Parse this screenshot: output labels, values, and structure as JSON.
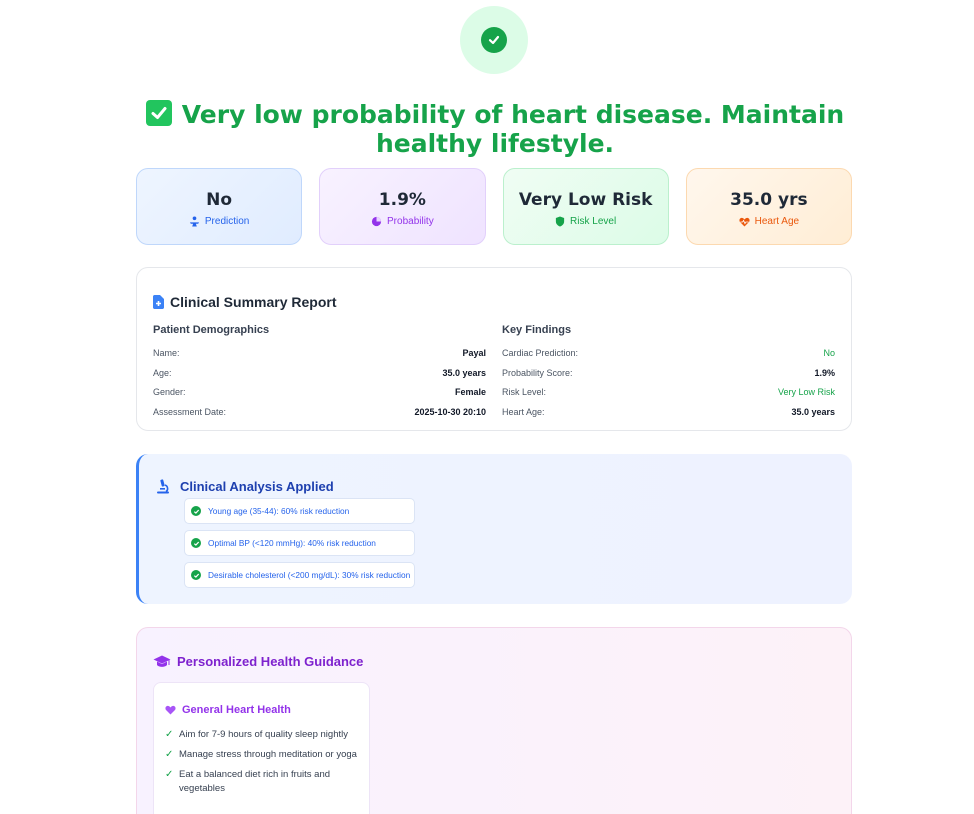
{
  "headline": "Very low probability of heart disease. Maintain healthy lifestyle.",
  "stats": [
    {
      "value": "No",
      "label": "Prediction",
      "icon": "person-icon",
      "color": "#2563eb"
    },
    {
      "value": "1.9%",
      "label": "Probability",
      "icon": "pie-chart-icon",
      "color": "#9333ea"
    },
    {
      "value": "Very Low Risk",
      "label": "Risk Level",
      "icon": "shield-icon",
      "color": "#16a34a"
    },
    {
      "value": "35.0 yrs",
      "label": "Heart Age",
      "icon": "heartbeat-icon",
      "color": "#ea580c"
    }
  ],
  "summary": {
    "title": "Clinical Summary Report",
    "demographics": {
      "heading": "Patient Demographics",
      "rows": [
        {
          "key": "Name:",
          "value": "Payal"
        },
        {
          "key": "Age:",
          "value": "35.0 years"
        },
        {
          "key": "Gender:",
          "value": "Female"
        },
        {
          "key": "Assessment Date:",
          "value": "2025-10-30 20:10"
        }
      ]
    },
    "findings": {
      "heading": "Key Findings",
      "rows": [
        {
          "key": "Cardiac Prediction:",
          "value": "No"
        },
        {
          "key": "Probability Score:",
          "value": "1.9%"
        },
        {
          "key": "Risk Level:",
          "value": "Very Low Risk"
        },
        {
          "key": "Heart Age:",
          "value": "35.0 years"
        }
      ]
    }
  },
  "analysis": {
    "title": "Clinical Analysis Applied",
    "items": [
      "Young age (35-44): 60% risk reduction",
      "Optimal BP (<120 mmHg): 40% risk reduction",
      "Desirable cholesterol (<200 mg/dL): 30% risk reduction"
    ]
  },
  "guidance": {
    "title": "Personalized Health Guidance",
    "card_title": "General Heart Health",
    "items": [
      "Aim for 7-9 hours of quality sleep nightly",
      "Manage stress through meditation or yoga",
      "Eat a balanced diet rich in fruits and vegetables"
    ]
  },
  "colors": {
    "success": "#16a34a",
    "primary": "#2563eb",
    "accent": "#9333ea",
    "warning": "#ea580c"
  }
}
